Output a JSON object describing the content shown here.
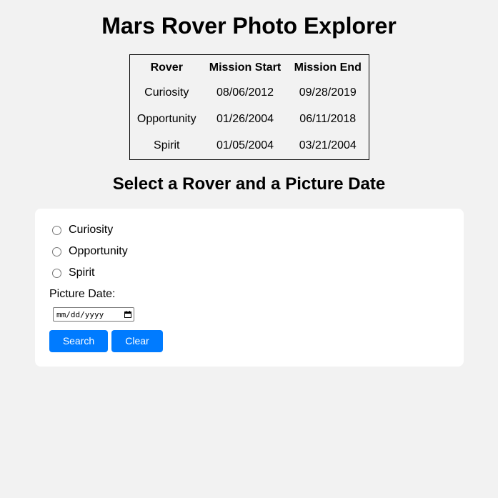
{
  "page": {
    "title": "Mars Rover Photo Explorer",
    "subtitle": "Select a Rover and a Picture Date"
  },
  "missions_table": {
    "headers": [
      "Rover",
      "Mission Start",
      "Mission End"
    ],
    "rows": [
      [
        "Curiosity",
        "08/06/2012",
        "09/28/2019"
      ],
      [
        "Opportunity",
        "01/26/2004",
        "06/11/2018"
      ],
      [
        "Spirit",
        "01/05/2004",
        "03/21/2004"
      ]
    ]
  },
  "form": {
    "rovers": [
      {
        "label": "Curiosity",
        "checked": false
      },
      {
        "label": "Opportunity",
        "checked": false
      },
      {
        "label": "Spirit",
        "checked": false
      }
    ],
    "date_label": "Picture Date:",
    "date_value": "mm/dd/yyyy",
    "search_label": "Search",
    "clear_label": "Clear"
  },
  "colors": {
    "background": "#f2f2f2",
    "panel": "#ffffff",
    "button": "#007bff",
    "button_text": "#ffffff"
  },
  "icons": {
    "date_picker": "calendar-icon"
  }
}
